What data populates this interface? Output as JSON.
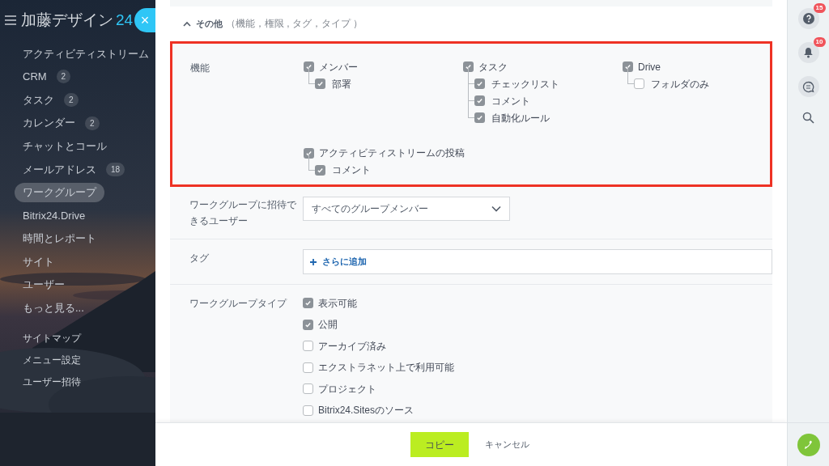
{
  "sidebar": {
    "title": "加藤デザイン",
    "title_suffix": "24",
    "close": "×",
    "items": [
      {
        "label": "アクティビティストリーム",
        "selected": false
      },
      {
        "label": "CRM",
        "count": "2",
        "selected": false
      },
      {
        "label": "タスク",
        "count": "2",
        "selected": false
      },
      {
        "label": "カレンダー",
        "count": "2",
        "selected": false
      },
      {
        "label": "チャットとコール",
        "selected": false
      },
      {
        "label": "メールアドレス",
        "count": "18",
        "selected": false
      },
      {
        "label": "ワークグループ",
        "selected": true
      },
      {
        "label": "Bitrix24.Drive",
        "selected": false
      },
      {
        "label": "時間とレポート",
        "selected": false
      },
      {
        "label": "サイト",
        "selected": false
      },
      {
        "label": "ユーザー",
        "selected": false
      },
      {
        "label": "もっと見る...",
        "selected": false
      }
    ],
    "links": [
      "サイトマップ",
      "メニュー設定",
      "ユーザー招待"
    ]
  },
  "section": {
    "title": "その他",
    "subtitle": "（機能，権限 , タグ，タイプ ）",
    "expanded": true
  },
  "features": {
    "label": "機能",
    "highlighted": true,
    "items": [
      {
        "label": "メンバー",
        "checked": true,
        "children": [
          {
            "label": "部署",
            "checked": true
          }
        ]
      },
      {
        "label": "タスク",
        "checked": true,
        "children": [
          {
            "label": "チェックリスト",
            "checked": true
          },
          {
            "label": "コメント",
            "checked": true
          },
          {
            "label": "自動化ルール",
            "checked": true
          }
        ]
      },
      {
        "label": "Drive",
        "checked": true,
        "children": [
          {
            "label": "フォルダのみ",
            "checked": false
          }
        ]
      },
      {
        "label": "アクティビティストリームの投稿",
        "checked": true,
        "children": [
          {
            "label": "コメント",
            "checked": true
          }
        ]
      }
    ]
  },
  "invite": {
    "label": "ワークグループに招待できるユーザー",
    "value": "すべてのグループメンバー"
  },
  "tags": {
    "label": "タグ",
    "add": "さらに追加"
  },
  "group_type": {
    "label": "ワークグループタイプ",
    "options": [
      {
        "label": "表示可能",
        "checked": true
      },
      {
        "label": "公開",
        "checked": true
      },
      {
        "label": "アーカイブ済み",
        "checked": false
      },
      {
        "label": "エクストラネット上で利用可能",
        "checked": false
      },
      {
        "label": "プロジェクト",
        "checked": false
      },
      {
        "label": "Bitrix24.Sitesのソース",
        "checked": false
      }
    ]
  },
  "footer": {
    "buttons": [
      {
        "label": "コピー",
        "kind": "primary"
      },
      {
        "label": "キャンセル",
        "kind": "link"
      }
    ]
  },
  "right_bar": {
    "help_badge": "15",
    "notify_badge": "10"
  }
}
